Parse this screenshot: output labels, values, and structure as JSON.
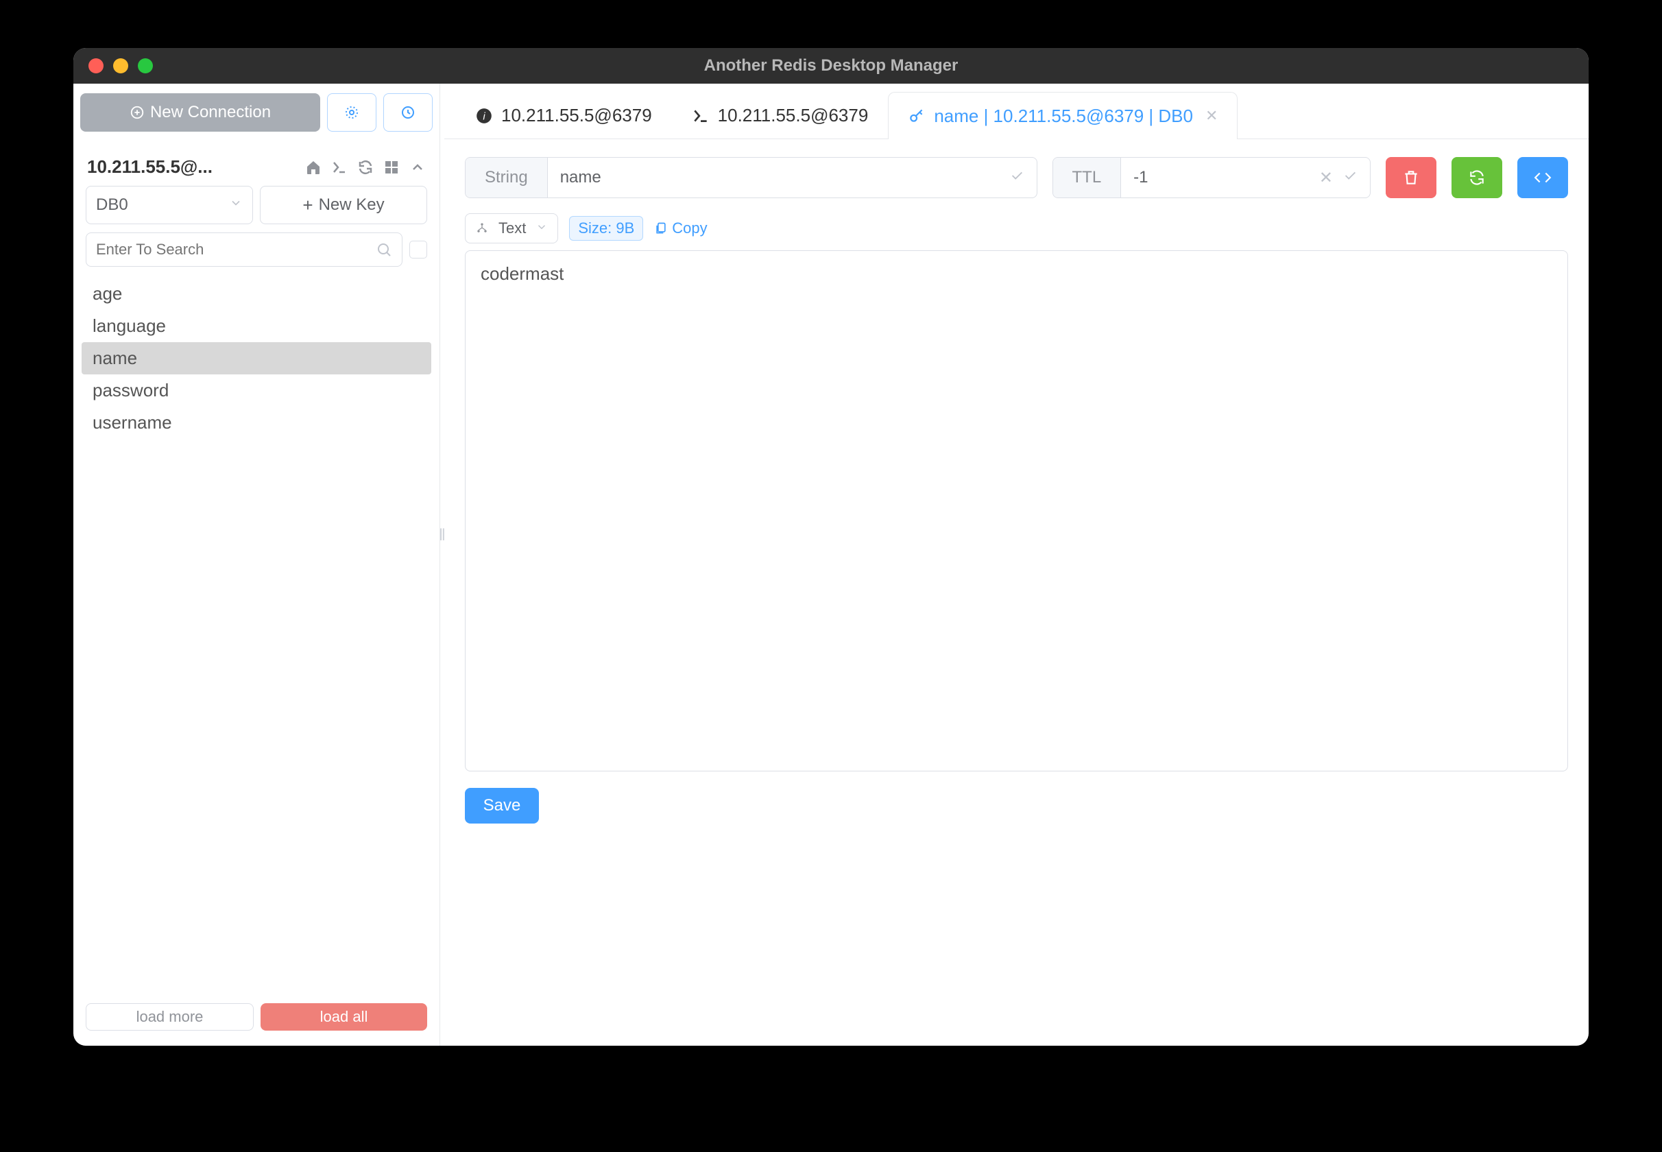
{
  "window": {
    "title": "Another Redis Desktop Manager"
  },
  "sidebar": {
    "new_connection": "New Connection",
    "connection_name": "10.211.55.5@...",
    "db_selected": "DB0",
    "new_key": "New Key",
    "search_placeholder": "Enter To Search",
    "keys": [
      "age",
      "language",
      "name",
      "password",
      "username"
    ],
    "selected_key_index": 2,
    "load_more": "load more",
    "load_all": "load all"
  },
  "tabs": [
    {
      "label": "10.211.55.5@6379",
      "icon": "info"
    },
    {
      "label": "10.211.55.5@6379",
      "icon": "terminal"
    },
    {
      "label": "name | 10.211.55.5@6379 | DB0",
      "icon": "key",
      "active": true,
      "closable": true
    }
  ],
  "detail": {
    "type_label": "String",
    "key_name": "name",
    "ttl_label": "TTL",
    "ttl_value": "-1",
    "format": "Text",
    "size_label": "Size: 9B",
    "copy_label": "Copy",
    "value": "codermast",
    "save_label": "Save"
  }
}
